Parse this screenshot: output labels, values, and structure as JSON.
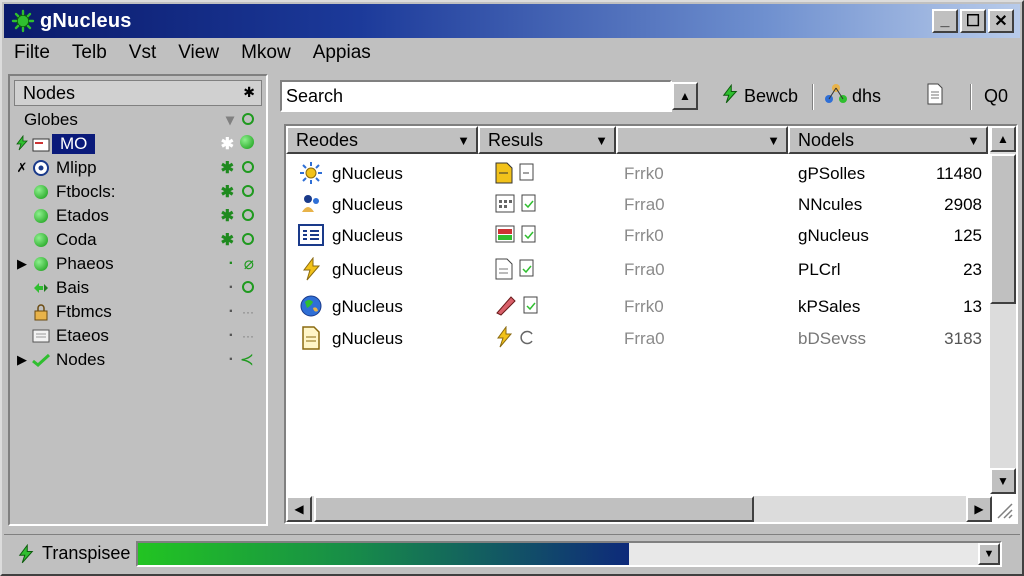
{
  "window": {
    "title": "gNucleus",
    "minimize": "_",
    "maximize": "☐",
    "close": "✕"
  },
  "menu": [
    "Filte",
    "Telb",
    "Vst",
    "View",
    "Mkow",
    "Appias"
  ],
  "left_panel": {
    "header": "Nodes",
    "pin": "✱",
    "rows": [
      {
        "label": "Globes",
        "s1": "▾",
        "expander": ""
      },
      {
        "label": "MO",
        "s1": "✱",
        "expander": ""
      },
      {
        "label": "Mlipp",
        "s1": "✱",
        "expander": "✗"
      },
      {
        "label": "Ftbocls:",
        "s1": "✱",
        "expander": ""
      },
      {
        "label": "Etados",
        "s1": "✱",
        "expander": ""
      },
      {
        "label": "Coda",
        "s1": "✱",
        "expander": ""
      },
      {
        "label": "Phaeos",
        "s1": "·",
        "expander": "▶"
      },
      {
        "label": "Bais",
        "s1": "·",
        "expander": ""
      },
      {
        "label": "Ftbmcs",
        "s1": "·",
        "expander": ""
      },
      {
        "label": "Etaeos",
        "s1": "·",
        "expander": ""
      },
      {
        "label": "Nodes",
        "s1": "·",
        "expander": "▶"
      }
    ]
  },
  "toolbar": {
    "search_value": "Search",
    "search_btn": "▲",
    "btn1": "Bewcb",
    "btn2": "dhs",
    "btn3": "Q0"
  },
  "results": {
    "columns": [
      "Reodes",
      "Resuls",
      "",
      "Nodels"
    ],
    "rows": [
      {
        "name": "gNucleus",
        "status": "Frrk0",
        "node": "gPSolles",
        "count": "11480"
      },
      {
        "name": "gNucleus",
        "status": "Frra0",
        "node": "NNcules",
        "count": "2908"
      },
      {
        "name": "gNucleus",
        "status": "Frrk0",
        "node": "gNucleus",
        "count": "125"
      },
      {
        "name": "gNucleus",
        "status": "Frra0",
        "node": "PLCrl",
        "count": "23"
      },
      {
        "name": "gNucleus",
        "status": "Frrk0",
        "node": "kPSales",
        "count": "13"
      },
      {
        "name": "gNucleus",
        "status": "Frra0",
        "node": "bDSevss",
        "count": "3183"
      }
    ]
  },
  "status": {
    "label": "Transpisee",
    "progress": 0.57,
    "button": "▼"
  },
  "colors": {
    "title_start": "#0a1a6b",
    "accent_green": "#1f9a1f",
    "selection": "#0a1a7a"
  }
}
